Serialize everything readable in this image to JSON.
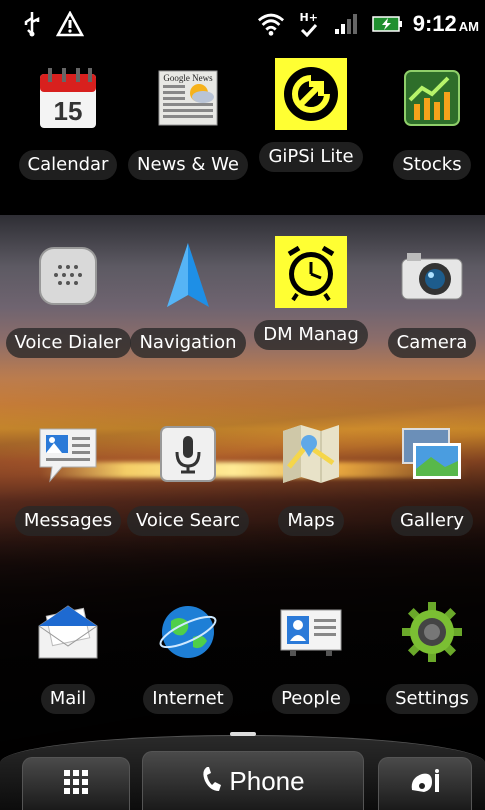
{
  "status_bar": {
    "time": "9:12",
    "ampm": "AM",
    "network": "H+"
  },
  "apps": [
    {
      "label": "Calendar",
      "icon": "calendar-icon",
      "date": "15"
    },
    {
      "label": "News & We",
      "icon": "news-weather-icon",
      "header": "Google News"
    },
    {
      "label": "GiPSi Lite",
      "icon": "gipsi-icon"
    },
    {
      "label": "Stocks",
      "icon": "stocks-icon"
    },
    {
      "label": "Voice Dialer",
      "icon": "voice-dialer-icon"
    },
    {
      "label": "Navigation",
      "icon": "navigation-icon"
    },
    {
      "label": "DM Manag",
      "icon": "dm-manager-icon"
    },
    {
      "label": "Camera",
      "icon": "camera-icon"
    },
    {
      "label": "Messages",
      "icon": "messages-icon"
    },
    {
      "label": "Voice Searc",
      "icon": "voice-search-icon"
    },
    {
      "label": "Maps",
      "icon": "maps-icon"
    },
    {
      "label": "Gallery",
      "icon": "gallery-icon"
    },
    {
      "label": "Mail",
      "icon": "mail-icon"
    },
    {
      "label": "Internet",
      "icon": "internet-icon"
    },
    {
      "label": "People",
      "icon": "people-icon"
    },
    {
      "label": "Settings",
      "icon": "settings-icon"
    }
  ],
  "dock": {
    "phone_label": "Phone"
  },
  "colors": {
    "gipsi_bg": "#ffff33",
    "label_bg": "#282828"
  }
}
